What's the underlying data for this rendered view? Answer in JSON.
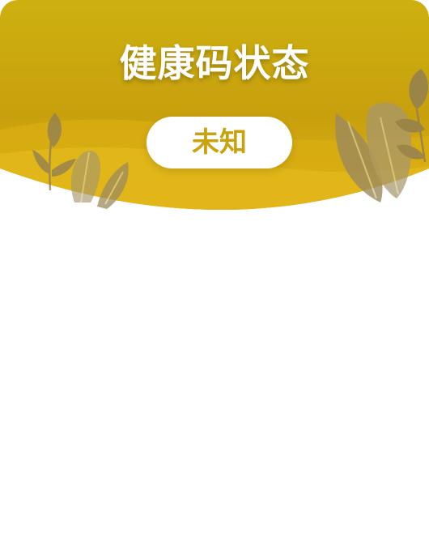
{
  "header": {
    "title": "健康码状态",
    "status_label": "未知"
  },
  "colors": {
    "header_top": "#cba90f",
    "header_bottom": "#ddb015",
    "status_text": "#c9a20e",
    "leaf": "#9c8a5e"
  },
  "icons": [
    "leaf-decoration-left",
    "leaf-decoration-right"
  ]
}
